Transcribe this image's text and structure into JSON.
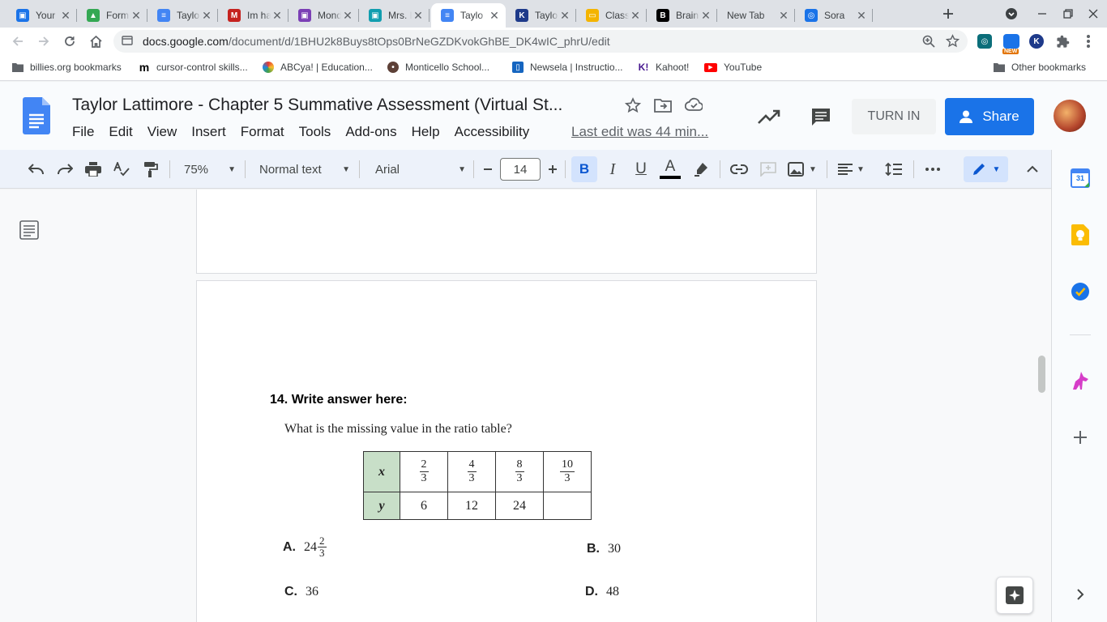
{
  "browser": {
    "tabs": [
      {
        "title": "Your",
        "icon": "classroom-icon",
        "color": "#1a73e8",
        "glyph": "▣",
        "active": false
      },
      {
        "title": "Form",
        "icon": "drive-icon",
        "color": "#34a853",
        "glyph": "▲",
        "active": false
      },
      {
        "title": "Taylo",
        "icon": "docs-icon",
        "color": "#4285f4",
        "glyph": "≡",
        "active": false
      },
      {
        "title": "Im ha",
        "icon": "gmail-icon",
        "color": "#c5221f",
        "glyph": "M",
        "active": false
      },
      {
        "title": "Mond",
        "icon": "classroom-icon",
        "color": "#7b3fb5",
        "glyph": "▣",
        "active": false
      },
      {
        "title": "Mrs. F",
        "icon": "classroom-icon",
        "color": "#129eaf",
        "glyph": "▣",
        "active": false
      },
      {
        "title": "Taylo",
        "icon": "docs-icon",
        "color": "#4285f4",
        "glyph": "≡",
        "active": true
      },
      {
        "title": "Taylo",
        "icon": "kami-icon",
        "color": "#1e3a8a",
        "glyph": "K",
        "active": false
      },
      {
        "title": "Class",
        "icon": "slides-icon",
        "color": "#f4b400",
        "glyph": "▭",
        "active": false
      },
      {
        "title": "Brainl",
        "icon": "brainly-icon",
        "color": "#000000",
        "glyph": "B",
        "active": false
      },
      {
        "title": "New Tab",
        "icon": "",
        "color": "",
        "glyph": "",
        "active": false
      },
      {
        "title": "Sora",
        "icon": "sora-icon",
        "color": "#1a73e8",
        "glyph": "◎",
        "active": false
      }
    ],
    "url_host": "docs.google.com",
    "url_path": "/document/d/1BHU2k8Buys8tOps0BrNeGZDKvokGhBE_DK4wIC_phrU/edit",
    "new_badge": "NEW"
  },
  "bookmarks": [
    {
      "label": "billies.org bookmarks",
      "icon": "folder-icon"
    },
    {
      "label": "cursor-control skills...",
      "icon": "m-icon"
    },
    {
      "label": "ABCya! | Education...",
      "icon": "abcya-icon"
    },
    {
      "label": "Monticello School...",
      "icon": "school-icon"
    },
    {
      "label": "Newsela | Instructio...",
      "icon": "newsela-icon"
    },
    {
      "label": "Kahoot!",
      "icon": "kahoot-icon"
    },
    {
      "label": "YouTube",
      "icon": "youtube-icon"
    }
  ],
  "other_bookmarks": "Other bookmarks",
  "docs": {
    "title": "Taylor Lattimore -  Chapter 5 Summative Assessment (Virtual St...",
    "menu": [
      "File",
      "Edit",
      "View",
      "Insert",
      "Format",
      "Tools",
      "Add-ons",
      "Help",
      "Accessibility"
    ],
    "last_edit": "Last edit was 44 min...",
    "turn_in": "TURN IN",
    "share": "Share"
  },
  "format_toolbar": {
    "zoom": "75%",
    "style": "Normal text",
    "font": "Arial",
    "font_size": "14"
  },
  "document": {
    "question_heading": "14.  Write answer here:",
    "question_text": "What is the missing value in the ratio table?",
    "table": {
      "x_label": "x",
      "y_label": "y",
      "x_values": [
        {
          "num": "2",
          "den": "3"
        },
        {
          "num": "4",
          "den": "3"
        },
        {
          "num": "8",
          "den": "3"
        },
        {
          "num": "10",
          "den": "3"
        }
      ],
      "y_values": [
        "6",
        "12",
        "24",
        ""
      ]
    },
    "choices": {
      "a_letter": "A.",
      "a_whole": "24",
      "a_num": "2",
      "a_den": "3",
      "b_letter": "B.",
      "b_value": "30",
      "c_letter": "C.",
      "c_value": "36",
      "d_letter": "D.",
      "d_value": "48"
    }
  },
  "side_panel": {
    "calendar_day": "31"
  }
}
